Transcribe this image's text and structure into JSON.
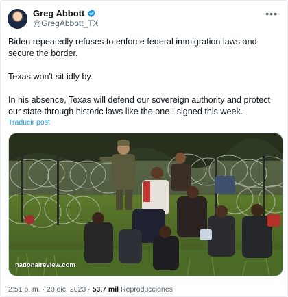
{
  "tweet": {
    "author": {
      "display_name": "Greg Abbott",
      "handle": "@GregAbbott_TX",
      "verified_icon": "verified-badge-icon"
    },
    "more_icon": "more-horizontal-icon",
    "paragraphs": [
      "Biden repeatedly refuses to enforce federal immigration laws and secure the border.",
      "Texas won't sit idly by.",
      "In his absence, Texas will defend our sovereign authority and protect our state through historic laws like the one I signed this week."
    ],
    "translate_label": "Traducir post",
    "media": {
      "source_label": "nationalreview.com"
    },
    "meta": {
      "timestamp": "2:51 p. m. · 20 dic. 2023 · ",
      "views_count": "53,7 mil",
      "views_label": " Reproducciones"
    }
  },
  "colors": {
    "link": "#1d9bf0",
    "secondary_text": "#536471",
    "primary_text": "#0f1419",
    "verified": "#1d9bf0"
  }
}
